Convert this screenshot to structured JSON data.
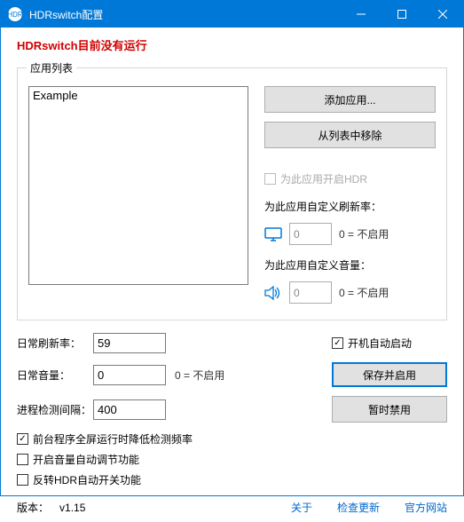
{
  "titlebar": {
    "title": "HDRswitch配置"
  },
  "status": "HDRswitch目前没有运行",
  "applist": {
    "legend": "应用列表",
    "items": [
      "Example"
    ],
    "add_label": "添加应用...",
    "remove_label": "从列表中移除",
    "enable_hdr_label": "为此应用开启HDR",
    "custom_refresh_label": "为此应用自定义刷新率：",
    "custom_volume_label": "为此应用自定义音量：",
    "refresh_value": "0",
    "volume_value": "0",
    "hint": "0 = 不启用"
  },
  "settings": {
    "refresh_label": "日常刷新率：",
    "refresh_value": "59",
    "volume_label": "日常音量：",
    "volume_value": "0",
    "volume_hint": "0 = 不启用",
    "interval_label": "进程检测间隔：",
    "interval_value": "400",
    "autostart_label": "开机自动启动",
    "save_label": "保存并启用",
    "disable_label": "暂时禁用"
  },
  "checks": {
    "c1": "前台程序全屏运行时降低检测频率",
    "c2": "开启音量自动调节功能",
    "c3": "反转HDR自动开关功能"
  },
  "footer": {
    "version_label": "版本：",
    "version": "v1.15",
    "about": "关于",
    "update": "检查更新",
    "site": "官方网站"
  }
}
